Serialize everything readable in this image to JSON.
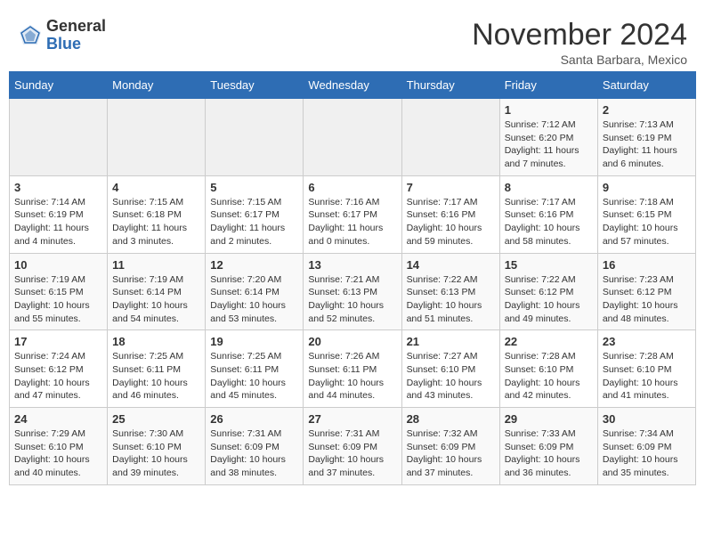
{
  "header": {
    "logo_general": "General",
    "logo_blue": "Blue",
    "month_title": "November 2024",
    "location": "Santa Barbara, Mexico"
  },
  "days_of_week": [
    "Sunday",
    "Monday",
    "Tuesday",
    "Wednesday",
    "Thursday",
    "Friday",
    "Saturday"
  ],
  "weeks": [
    [
      {
        "num": "",
        "info": ""
      },
      {
        "num": "",
        "info": ""
      },
      {
        "num": "",
        "info": ""
      },
      {
        "num": "",
        "info": ""
      },
      {
        "num": "",
        "info": ""
      },
      {
        "num": "1",
        "info": "Sunrise: 7:12 AM\nSunset: 6:20 PM\nDaylight: 11 hours and 7 minutes."
      },
      {
        "num": "2",
        "info": "Sunrise: 7:13 AM\nSunset: 6:19 PM\nDaylight: 11 hours and 6 minutes."
      }
    ],
    [
      {
        "num": "3",
        "info": "Sunrise: 7:14 AM\nSunset: 6:19 PM\nDaylight: 11 hours and 4 minutes."
      },
      {
        "num": "4",
        "info": "Sunrise: 7:15 AM\nSunset: 6:18 PM\nDaylight: 11 hours and 3 minutes."
      },
      {
        "num": "5",
        "info": "Sunrise: 7:15 AM\nSunset: 6:17 PM\nDaylight: 11 hours and 2 minutes."
      },
      {
        "num": "6",
        "info": "Sunrise: 7:16 AM\nSunset: 6:17 PM\nDaylight: 11 hours and 0 minutes."
      },
      {
        "num": "7",
        "info": "Sunrise: 7:17 AM\nSunset: 6:16 PM\nDaylight: 10 hours and 59 minutes."
      },
      {
        "num": "8",
        "info": "Sunrise: 7:17 AM\nSunset: 6:16 PM\nDaylight: 10 hours and 58 minutes."
      },
      {
        "num": "9",
        "info": "Sunrise: 7:18 AM\nSunset: 6:15 PM\nDaylight: 10 hours and 57 minutes."
      }
    ],
    [
      {
        "num": "10",
        "info": "Sunrise: 7:19 AM\nSunset: 6:15 PM\nDaylight: 10 hours and 55 minutes."
      },
      {
        "num": "11",
        "info": "Sunrise: 7:19 AM\nSunset: 6:14 PM\nDaylight: 10 hours and 54 minutes."
      },
      {
        "num": "12",
        "info": "Sunrise: 7:20 AM\nSunset: 6:14 PM\nDaylight: 10 hours and 53 minutes."
      },
      {
        "num": "13",
        "info": "Sunrise: 7:21 AM\nSunset: 6:13 PM\nDaylight: 10 hours and 52 minutes."
      },
      {
        "num": "14",
        "info": "Sunrise: 7:22 AM\nSunset: 6:13 PM\nDaylight: 10 hours and 51 minutes."
      },
      {
        "num": "15",
        "info": "Sunrise: 7:22 AM\nSunset: 6:12 PM\nDaylight: 10 hours and 49 minutes."
      },
      {
        "num": "16",
        "info": "Sunrise: 7:23 AM\nSunset: 6:12 PM\nDaylight: 10 hours and 48 minutes."
      }
    ],
    [
      {
        "num": "17",
        "info": "Sunrise: 7:24 AM\nSunset: 6:12 PM\nDaylight: 10 hours and 47 minutes."
      },
      {
        "num": "18",
        "info": "Sunrise: 7:25 AM\nSunset: 6:11 PM\nDaylight: 10 hours and 46 minutes."
      },
      {
        "num": "19",
        "info": "Sunrise: 7:25 AM\nSunset: 6:11 PM\nDaylight: 10 hours and 45 minutes."
      },
      {
        "num": "20",
        "info": "Sunrise: 7:26 AM\nSunset: 6:11 PM\nDaylight: 10 hours and 44 minutes."
      },
      {
        "num": "21",
        "info": "Sunrise: 7:27 AM\nSunset: 6:10 PM\nDaylight: 10 hours and 43 minutes."
      },
      {
        "num": "22",
        "info": "Sunrise: 7:28 AM\nSunset: 6:10 PM\nDaylight: 10 hours and 42 minutes."
      },
      {
        "num": "23",
        "info": "Sunrise: 7:28 AM\nSunset: 6:10 PM\nDaylight: 10 hours and 41 minutes."
      }
    ],
    [
      {
        "num": "24",
        "info": "Sunrise: 7:29 AM\nSunset: 6:10 PM\nDaylight: 10 hours and 40 minutes."
      },
      {
        "num": "25",
        "info": "Sunrise: 7:30 AM\nSunset: 6:10 PM\nDaylight: 10 hours and 39 minutes."
      },
      {
        "num": "26",
        "info": "Sunrise: 7:31 AM\nSunset: 6:09 PM\nDaylight: 10 hours and 38 minutes."
      },
      {
        "num": "27",
        "info": "Sunrise: 7:31 AM\nSunset: 6:09 PM\nDaylight: 10 hours and 37 minutes."
      },
      {
        "num": "28",
        "info": "Sunrise: 7:32 AM\nSunset: 6:09 PM\nDaylight: 10 hours and 37 minutes."
      },
      {
        "num": "29",
        "info": "Sunrise: 7:33 AM\nSunset: 6:09 PM\nDaylight: 10 hours and 36 minutes."
      },
      {
        "num": "30",
        "info": "Sunrise: 7:34 AM\nSunset: 6:09 PM\nDaylight: 10 hours and 35 minutes."
      }
    ]
  ]
}
